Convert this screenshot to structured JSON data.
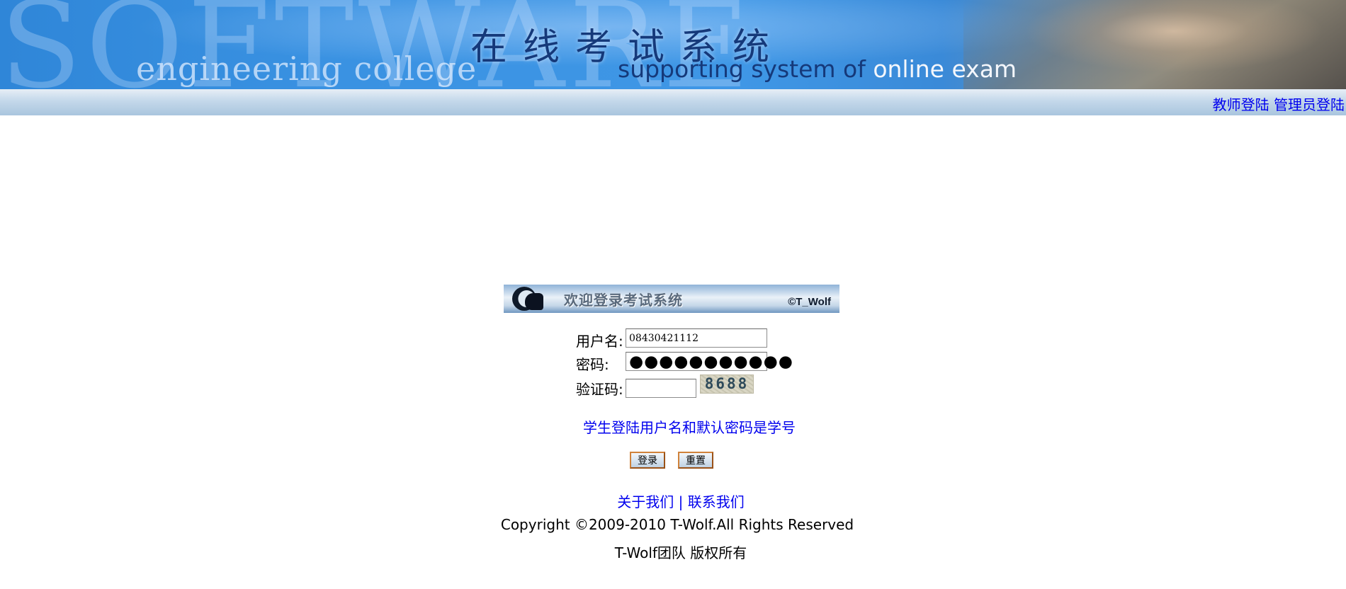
{
  "banner": {
    "background_word": "SOFTWARE",
    "college": "engineering college",
    "title_cn": "在线考试系统",
    "tagline_prefix": "supporting system of ",
    "tagline_highlight": "online exam"
  },
  "topbar": {
    "teacher_login": "教师登陆",
    "admin_login": "管理员登陆"
  },
  "welcome": {
    "title": "欢迎登录考试系统",
    "copyright_mark": "©T_Wolf"
  },
  "form": {
    "username_label": "用户名:",
    "username_value": "08430421112",
    "password_label": "密码:",
    "password_mask": "●●●●●●●●●●●",
    "captcha_label": "验证码:",
    "captcha_value": "",
    "captcha_image_text": "8688"
  },
  "hint": "学生登陆用户名和默认密码是学号",
  "buttons": {
    "login": "登录",
    "reset": "重置"
  },
  "footer": {
    "about_us": "关于我们",
    "separator": "|",
    "contact_us": "联系我们",
    "copyright": "Copyright ©2009-2010 T-Wolf.All Rights Reserved",
    "team": "T-Wolf团队 版权所有"
  },
  "colors": {
    "banner_blue": "#3a92e2",
    "link_blue": "#0000ee",
    "banner_text": "#15397a",
    "button_border": "#d0823a"
  }
}
